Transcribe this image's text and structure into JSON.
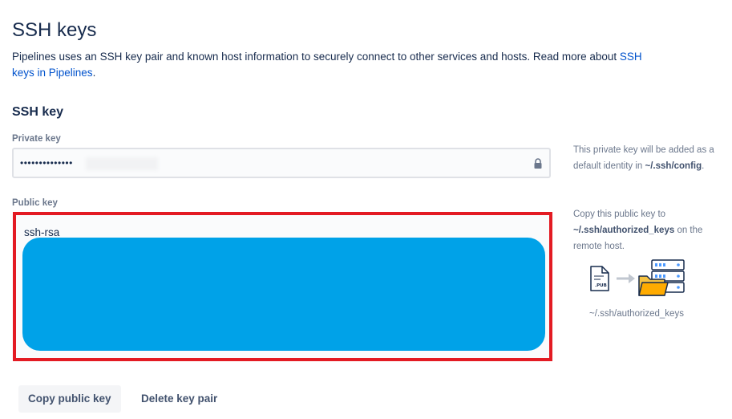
{
  "page": {
    "title": "SSH keys",
    "intro_text": "Pipelines uses an SSH key pair and known host information to securely connect to other services and hosts. Read more about ",
    "intro_link": "SSH keys in Pipelines",
    "intro_suffix": "."
  },
  "ssh_key": {
    "section_title": "SSH key",
    "private_key": {
      "label": "Private key",
      "value": "••••••••••••••",
      "help_text_prefix": "This private key will be added as a default identity in ",
      "help_text_path": "~/.ssh/config",
      "help_text_suffix": "."
    },
    "public_key": {
      "label": "Public key",
      "value_prefix": "ssh-rsa",
      "help_text_prefix": "Copy this public key to ",
      "help_text_path": "~/.ssh/authorized_keys",
      "help_text_suffix": " on the remote host.",
      "illustration_file_label": ".PUB",
      "illustration_caption": "~/.ssh/authorized_keys"
    }
  },
  "actions": {
    "copy_label": "Copy public key",
    "delete_label": "Delete key pair"
  },
  "colors": {
    "redaction": "#00a2e8",
    "highlight_outline": "#e31b23",
    "link": "#0052cc",
    "folder": "#f6c342"
  },
  "icons": {
    "private_key_field": "lock-icon",
    "public_key_illustration": [
      "pub-file-icon",
      "arrow-right-icon",
      "server-icon",
      "folder-icon"
    ]
  }
}
